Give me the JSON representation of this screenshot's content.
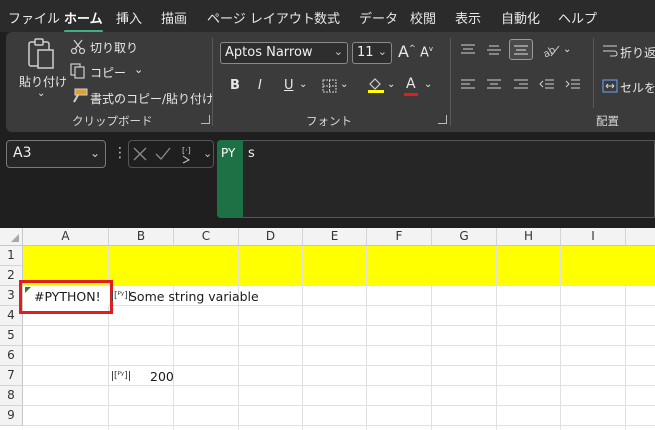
{
  "menu": [
    "ファイル",
    "ホーム",
    "挿入",
    "描画",
    "ページ レイアウト",
    "数式",
    "データ",
    "校閲",
    "表示",
    "自動化",
    "ヘルプ"
  ],
  "menu_active_index": 1,
  "clipboard": {
    "paste": "貼り付け",
    "cut": "切り取り",
    "copy": "コピー",
    "format_painter": "書式のコピー/貼り付け",
    "group_label": "クリップボード"
  },
  "font": {
    "name": "Aptos Narrow",
    "size": "11",
    "group_label": "フォント",
    "bold": "B",
    "italic": "I",
    "underline": "U",
    "grow": "A",
    "shrink": "A",
    "font_color_glyph": "A"
  },
  "alignment": {
    "wrap": "折り返",
    "merge": "セルを",
    "group_label": "配置"
  },
  "formula_bar": {
    "name_box": "A3",
    "py_tag": "PY",
    "formula": "s"
  },
  "columns": [
    "A",
    "B",
    "C",
    "D",
    "E",
    "F",
    "G",
    "H",
    "I"
  ],
  "rows": [
    "1",
    "2",
    "3",
    "4",
    "5",
    "6",
    "7",
    "8",
    "9"
  ],
  "cells": {
    "a3": "#PYTHON!",
    "b3_badge": "[ᴾʸ]",
    "b3": "Some string variable",
    "b7_badge": "[ᴾʸ]",
    "b7": "200"
  },
  "colors": {
    "accent": "#3fb37f",
    "py_green": "#1e7145",
    "highlight": "#ffff00",
    "error_border": "#e01e1e"
  }
}
